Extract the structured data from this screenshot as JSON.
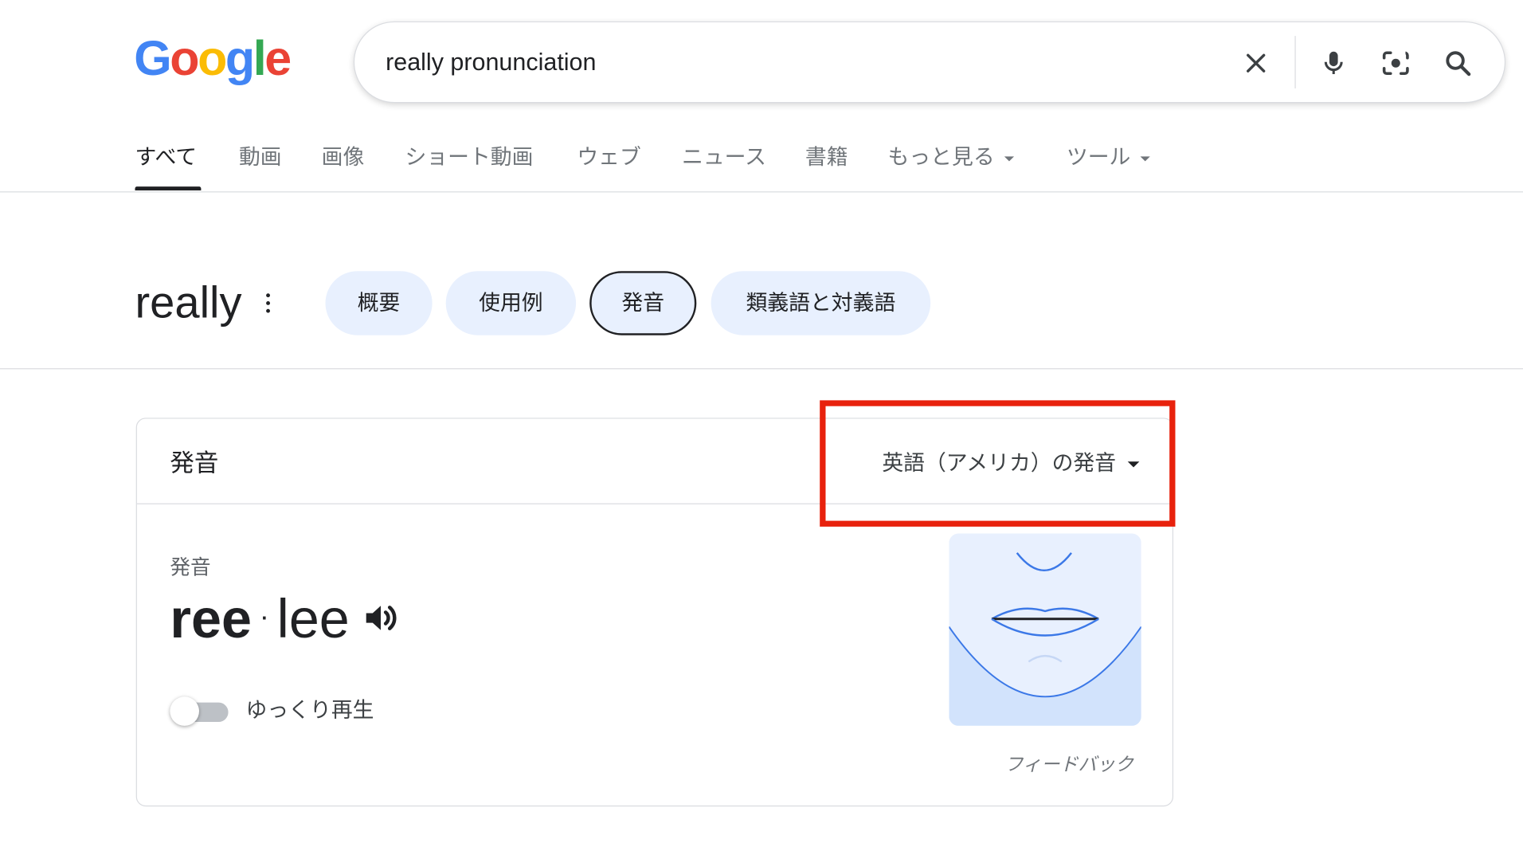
{
  "logo": {
    "letters": [
      "G",
      "o",
      "o",
      "g",
      "l",
      "e"
    ],
    "colors": [
      "#4285F4",
      "#EA4335",
      "#FBBC05",
      "#4285F4",
      "#34A853",
      "#EA4335"
    ]
  },
  "search": {
    "query": "really pronunciation",
    "icons": [
      "close-icon",
      "mic-icon",
      "camera-lens-icon",
      "search-icon"
    ]
  },
  "tabs": [
    {
      "label": "すべて",
      "active": true
    },
    {
      "label": "動画"
    },
    {
      "label": "画像"
    },
    {
      "label": "ショート動画"
    },
    {
      "label": "ウェブ"
    },
    {
      "label": "ニュース"
    },
    {
      "label": "書籍"
    },
    {
      "label": "もっと見る",
      "dropdown": true
    },
    {
      "label": "ツール",
      "dropdown": true
    }
  ],
  "word": "really",
  "chips": [
    {
      "label": "概要"
    },
    {
      "label": "使用例"
    },
    {
      "label": "発音",
      "selected": true
    },
    {
      "label": "類義語と対義語"
    }
  ],
  "card": {
    "title": "発音",
    "dialect": "英語（アメリカ）の発音",
    "pron_label": "発音",
    "syllables": [
      "ree",
      "lee"
    ],
    "separator": "·",
    "slow_play_label": "ゆっくり再生",
    "slow_play_on": false,
    "feedback": "フィードバック"
  },
  "colors": {
    "highlight": "#e8220d",
    "chip_bg": "#e8f0fe",
    "mouth_bg": "#e8f0fe",
    "mouth_chin": "#d2e3fc",
    "mouth_line": "#3b78e7"
  }
}
